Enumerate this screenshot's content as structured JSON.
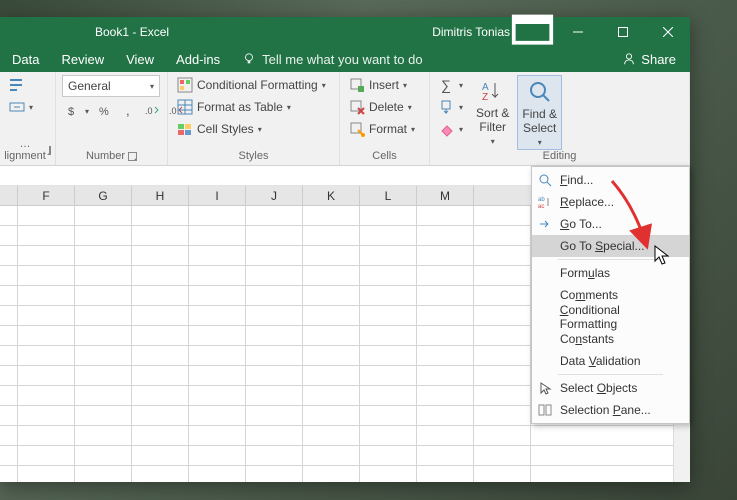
{
  "titlebar": {
    "title": "Book1 - Excel",
    "user": "Dimitris Tonias"
  },
  "menubar": {
    "tabs": [
      "Data",
      "Review",
      "View",
      "Add-ins"
    ],
    "tell": "Tell me what you want to do",
    "share": "Share"
  },
  "ribbon": {
    "alignment": {
      "label": "…lignment"
    },
    "number": {
      "label": "Number",
      "format": "General"
    },
    "styles": {
      "label": "Styles",
      "cond": "Conditional Formatting",
      "table": "Format as Table",
      "cell": "Cell Styles"
    },
    "cells": {
      "label": "Cells",
      "insert": "Insert",
      "delete": "Delete",
      "format": "Format"
    },
    "editing": {
      "label": "Editing",
      "sort": "Sort &\nFilter",
      "find": "Find &\nSelect"
    }
  },
  "columns": [
    "",
    "F",
    "G",
    "H",
    "I",
    "J",
    "K",
    "L",
    "M",
    ""
  ],
  "dropdown": {
    "find": "Find...",
    "replace": "Replace...",
    "goto": "Go To...",
    "gotospecial": "Go To Special...",
    "formulas": "Formulas",
    "comments": "Comments",
    "condfmt": "Conditional Formatting",
    "constants": "Constants",
    "datavalid": "Data Validation",
    "selobj": "Select Objects",
    "selpane": "Selection Pane..."
  }
}
